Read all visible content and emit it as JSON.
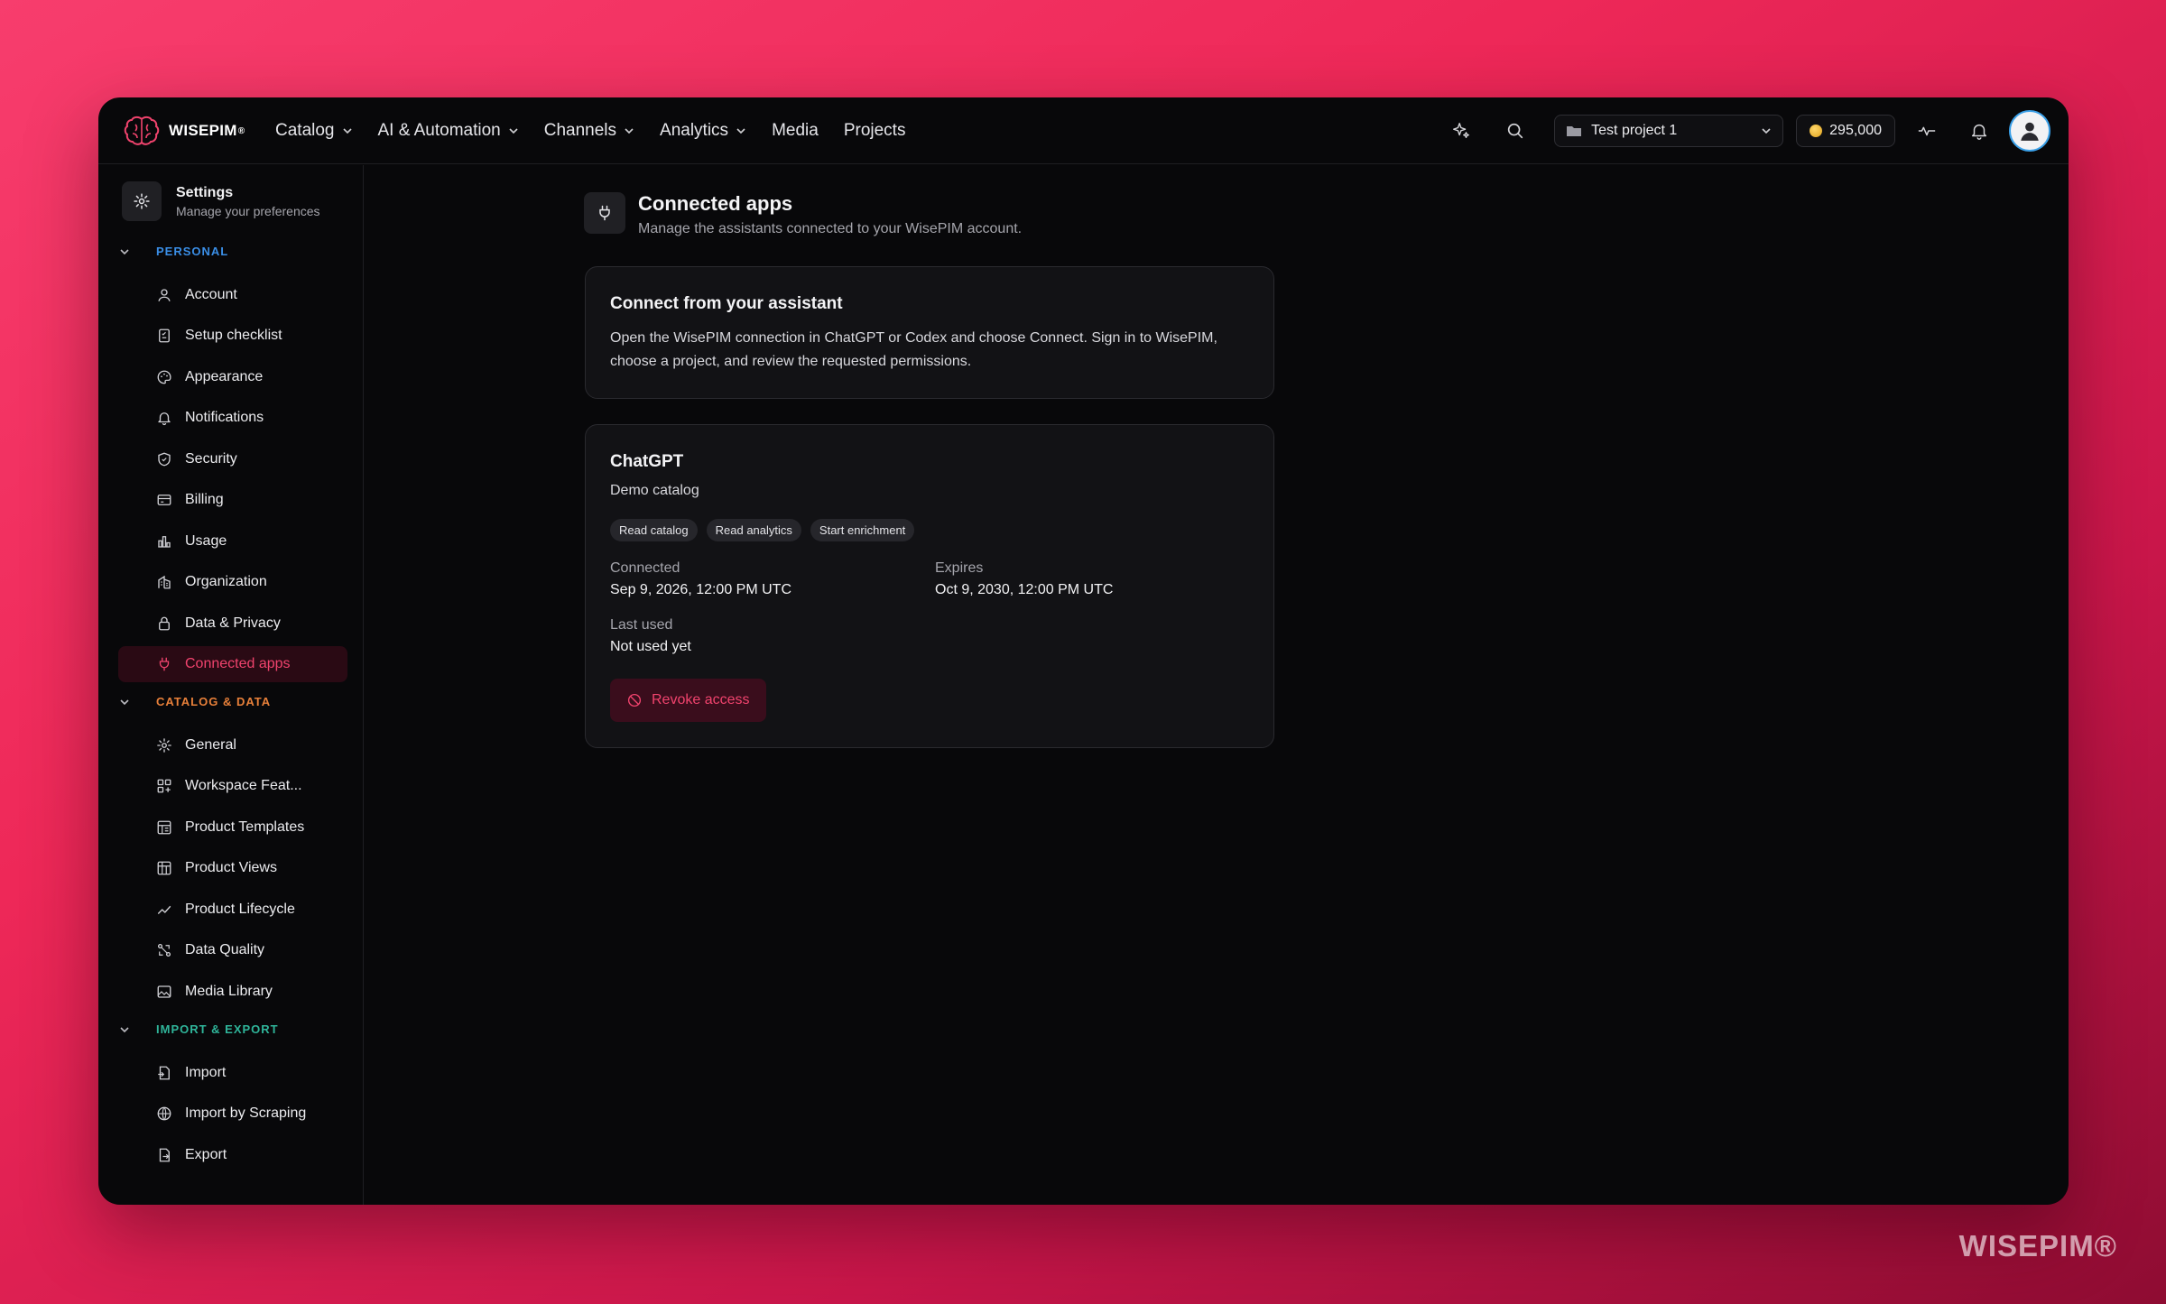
{
  "brand": {
    "name": "WISEPIM"
  },
  "nav": [
    {
      "label": "Catalog",
      "dropdown": true
    },
    {
      "label": "AI & Automation",
      "dropdown": true
    },
    {
      "label": "Channels",
      "dropdown": true
    },
    {
      "label": "Analytics",
      "dropdown": true
    },
    {
      "label": "Media",
      "dropdown": false
    },
    {
      "label": "Projects",
      "dropdown": false
    }
  ],
  "topbar": {
    "project": "Test project 1",
    "credits": "295,000",
    "icons": [
      "sparkles-icon",
      "search-icon",
      "activity-icon",
      "bell-icon",
      "avatar-icon"
    ]
  },
  "sidebar": {
    "title": "Settings",
    "subtitle": "Manage your preferences",
    "sections": [
      {
        "label": "PERSONAL",
        "color": "#3a8ee6",
        "items": [
          {
            "label": "Account",
            "icon": "user-icon"
          },
          {
            "label": "Setup checklist",
            "icon": "checklist-icon"
          },
          {
            "label": "Appearance",
            "icon": "palette-icon"
          },
          {
            "label": "Notifications",
            "icon": "bell-icon"
          },
          {
            "label": "Security",
            "icon": "shield-icon"
          },
          {
            "label": "Billing",
            "icon": "credit-card-icon"
          },
          {
            "label": "Usage",
            "icon": "bar-chart-icon"
          },
          {
            "label": "Organization",
            "icon": "organization-icon"
          },
          {
            "label": "Data & Privacy",
            "icon": "lock-icon"
          },
          {
            "label": "Connected apps",
            "icon": "plug-icon",
            "active": true
          }
        ]
      },
      {
        "label": "CATALOG & DATA",
        "color": "#e8803a",
        "items": [
          {
            "label": "General",
            "icon": "gear-icon"
          },
          {
            "label": "Workspace Feat...",
            "icon": "grid-plus-icon"
          },
          {
            "label": "Product Templates",
            "icon": "template-icon"
          },
          {
            "label": "Product Views",
            "icon": "table-icon"
          },
          {
            "label": "Product Lifecycle",
            "icon": "trend-icon"
          },
          {
            "label": "Data Quality",
            "icon": "quality-icon"
          },
          {
            "label": "Media Library",
            "icon": "image-icon"
          }
        ]
      },
      {
        "label": "IMPORT & EXPORT",
        "color": "#2fb59a",
        "items": [
          {
            "label": "Import",
            "icon": "file-import-icon"
          },
          {
            "label": "Import by Scraping",
            "icon": "globe-icon"
          },
          {
            "label": "Export",
            "icon": "file-export-icon"
          }
        ]
      }
    ]
  },
  "main": {
    "title": "Connected apps",
    "subtitle": "Manage the assistants connected to your WisePIM account.",
    "connect_card": {
      "title": "Connect from your assistant",
      "body": "Open the WisePIM connection in ChatGPT or Codex and choose Connect. Sign in to WisePIM, choose a project, and review the requested permissions."
    },
    "app": {
      "name": "ChatGPT",
      "project": "Demo catalog",
      "scopes": [
        "Read catalog",
        "Read analytics",
        "Start enrichment"
      ],
      "connected_label": "Connected",
      "connected_value": "Sep 9, 2026, 12:00 PM UTC",
      "expires_label": "Expires",
      "expires_value": "Oct 9, 2030, 12:00 PM UTC",
      "last_used_label": "Last used",
      "last_used_value": "Not used yet",
      "revoke_label": "Revoke access"
    }
  },
  "watermark": "WISEPIM®",
  "colors": {
    "accent": "#f0436d",
    "background": "#08080a",
    "card": "#121215"
  }
}
